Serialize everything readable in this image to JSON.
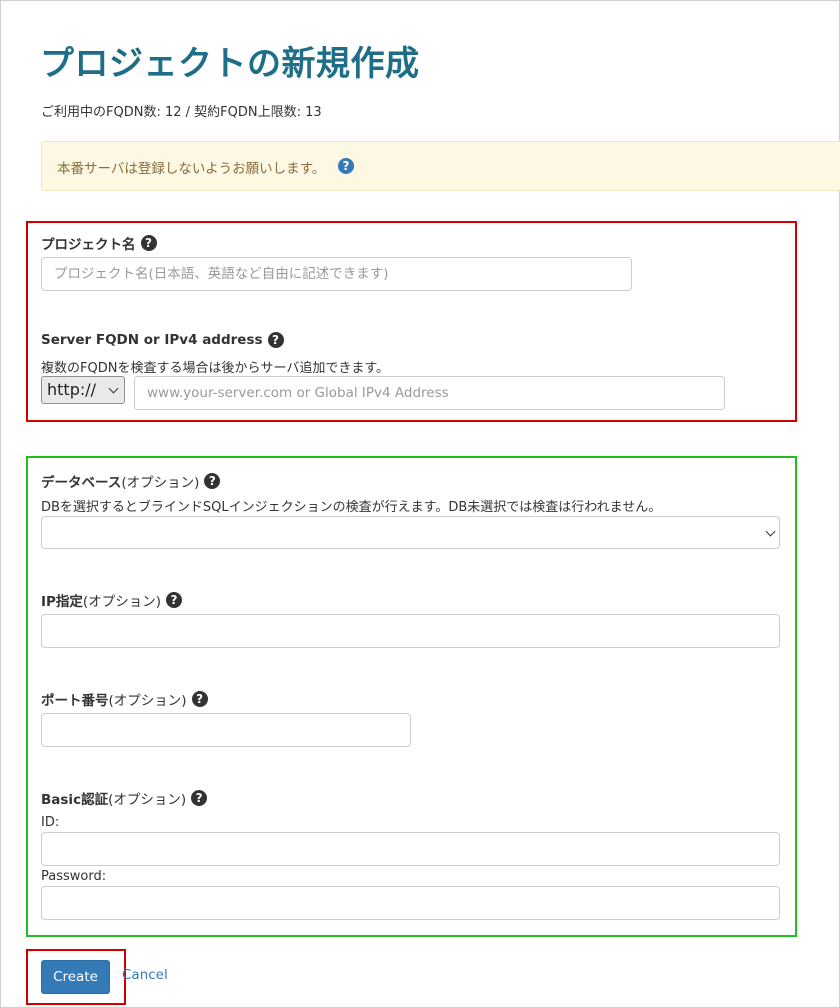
{
  "page": {
    "title": "プロジェクトの新規作成",
    "usage": "ご利用中のFQDN数: 12 / 契約FQDN上限数: 13"
  },
  "notice": {
    "text": "本番サーバは登録しないようお願いします。",
    "icon": "help-circle-icon",
    "icon_glyph": "?"
  },
  "form": {
    "project_name": {
      "label": "プロジェクト名",
      "placeholder": "プロジェクト名(日本語、英語など自由に記述できます)"
    },
    "server": {
      "label": "Server FQDN or IPv4 address",
      "hint": "複数のFQDNを検査する場合は後からサーバ追加できます。",
      "protocol_selected": "http://",
      "placeholder": "www.your-server.com or Global IPv4 Address"
    },
    "database": {
      "label": "データベース",
      "optional": "(オプション)",
      "hint": "DBを選択するとブラインドSQLインジェクションの検査が行えます。DB未選択では検査は行われません。",
      "selected": ""
    },
    "ip": {
      "label": "IP指定",
      "optional": "(オプション)",
      "value": ""
    },
    "port": {
      "label": "ポート番号",
      "optional": "(オプション)",
      "value": ""
    },
    "basic_auth": {
      "label": "Basic認証",
      "optional": "(オプション)",
      "id_label": "ID:",
      "id_value": "",
      "password_label": "Password:",
      "password_value": ""
    }
  },
  "help_glyph": "?",
  "actions": {
    "create_label": "Create",
    "cancel_label": "Cancel"
  },
  "colors": {
    "title": "#1d6e86",
    "primary": "#337ab7",
    "notice_bg": "#fcf8e3",
    "notice_text": "#8a6d3b",
    "annotation_red": "#d40000",
    "annotation_green": "#1fbf1f"
  }
}
